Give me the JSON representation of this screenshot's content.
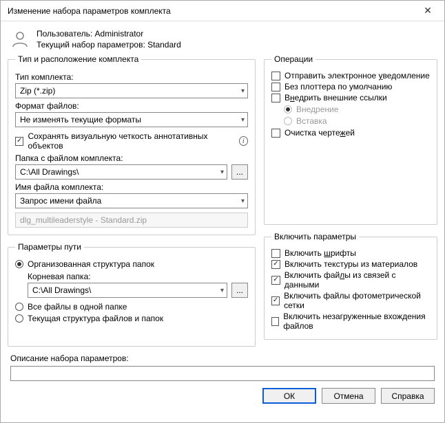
{
  "window": {
    "title": "Изменение набора параметров комплекта"
  },
  "header": {
    "user_label": "Пользователь: Administrator",
    "setup_label": "Текущий набор параметров: Standard"
  },
  "group_type": {
    "legend": "Тип и расположение комплекта",
    "type_label": "Тип комплекта:",
    "type_value": "Zip (*.zip)",
    "format_label": "Формат файлов:",
    "format_value": "Не изменять текущие форматы",
    "annot_checkbox": "Сохранять визуальную четкость аннотативных объектов",
    "folder_label": "Папка с файлом комплекта:",
    "folder_value": "C:\\All Drawings\\",
    "filename_label": "Имя файла комплекта:",
    "filename_value": "Запрос имени файла",
    "preview": "dlg_multileaderstyle - Standard.zip",
    "browse": "..."
  },
  "group_path": {
    "legend": "Параметры пути",
    "r_org": "Организованная структура папок",
    "root_label": "Корневая папка:",
    "root_value": "C:\\All Drawings\\",
    "r_flat": "Все файлы в одной папке",
    "r_current": "Текущая структура файлов и папок",
    "browse": "..."
  },
  "group_ops": {
    "legend": "Операции",
    "c_email_before": "Отправить электронное ",
    "c_email_u": "у",
    "c_email_after": "ведомление",
    "c_plotter": "Без плоттера по умолчанию",
    "c_xref_before": "В",
    "c_xref_u": "н",
    "c_xref_after": "едрить внешние ссылки",
    "r_embed": "Внедрение",
    "r_insert": "Вставка",
    "c_purge_before": "Очистка черте",
    "c_purge_u": "ж",
    "c_purge_after": "ей"
  },
  "group_include": {
    "legend": "Включить параметры",
    "c_fonts_before": "Включить ",
    "c_fonts_u": "ш",
    "c_fonts_after": "рифты",
    "c_textures": "Включить текстуры из материалов",
    "c_data_before": "Включить фай",
    "c_data_u": "л",
    "c_data_after": "ы из связей с данными",
    "c_photo": "Включить файлы фотометрической сетки",
    "c_unloaded": "Включить незагруженные вхождения файлов"
  },
  "desc": {
    "label": "Описание набора параметров:",
    "value": ""
  },
  "buttons": {
    "ok": "ОК",
    "cancel": "Отмена",
    "help": "Справка"
  }
}
